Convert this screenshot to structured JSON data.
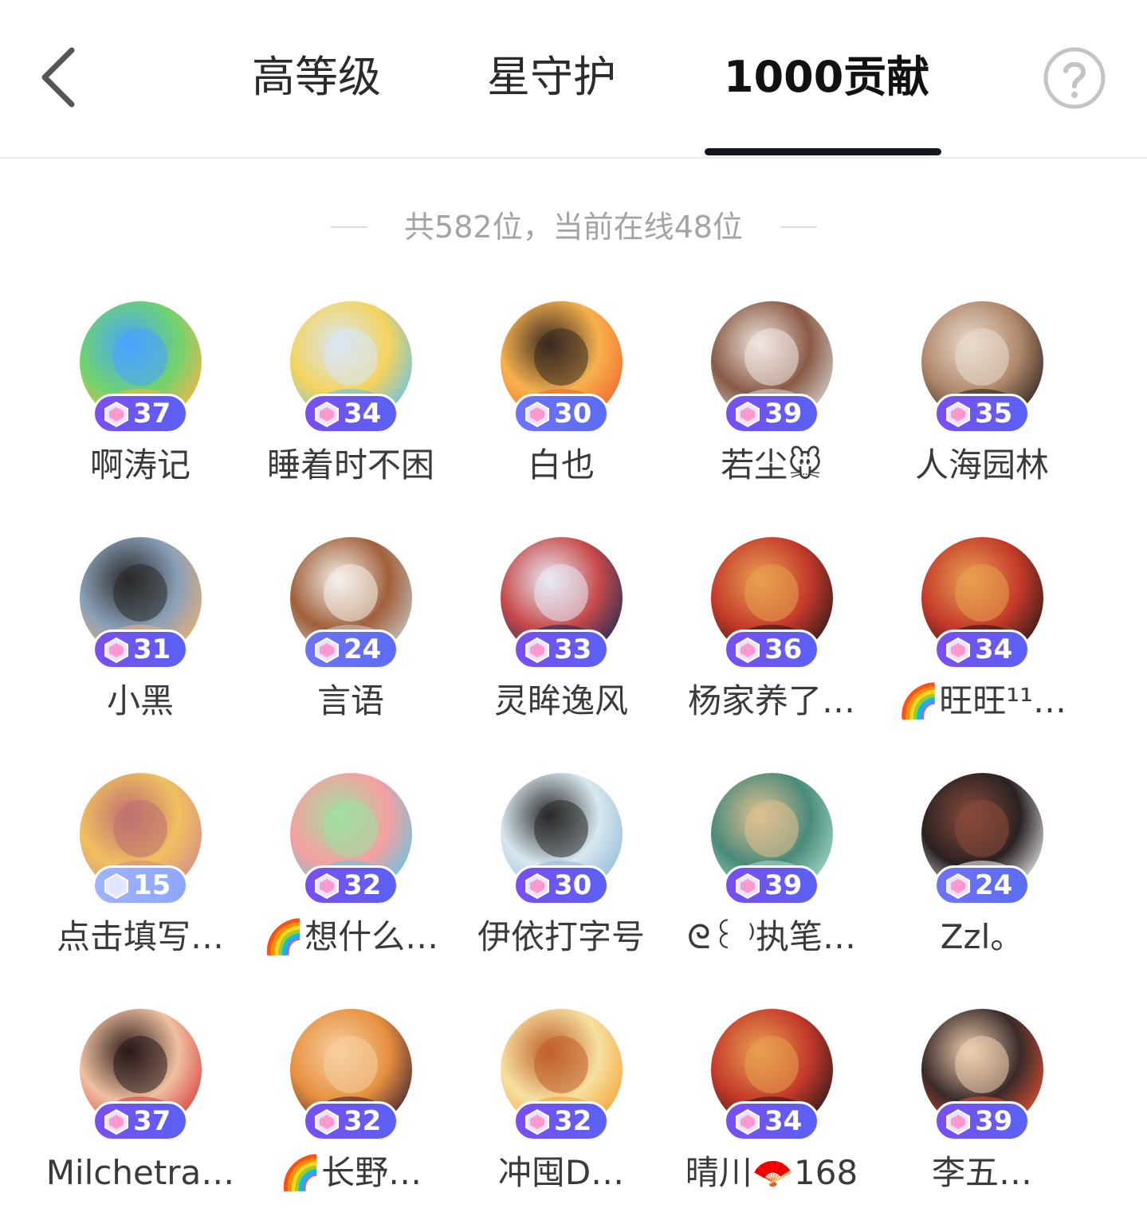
{
  "header": {
    "tabs": [
      {
        "label": "高等级",
        "active": false
      },
      {
        "label": "星守护",
        "active": false
      },
      {
        "label": "1000贡献",
        "active": true
      }
    ],
    "back_icon": "chevron-left-icon",
    "help_icon": "question-circle-icon"
  },
  "summary": {
    "text": "共582位，当前在线48位"
  },
  "members": [
    {
      "name": "啊涛记",
      "level": "37",
      "badge": "purple",
      "avatar_colors": [
        "#ffb347",
        "#6fd36f",
        "#4aa3ff"
      ]
    },
    {
      "name": "睡着时不困",
      "level": "34",
      "badge": "purple",
      "avatar_colors": [
        "#5ec2f0",
        "#f4d35e",
        "#d9e8f5"
      ]
    },
    {
      "name": "白也",
      "level": "30",
      "badge": "blue",
      "avatar_colors": [
        "#f0632b",
        "#f7b24d",
        "#3a2a20"
      ]
    },
    {
      "name": "若尘🐭",
      "level": "39",
      "badge": "purple",
      "avatar_colors": [
        "#d9d6d4",
        "#8a5a45",
        "#f0e6e0"
      ]
    },
    {
      "name": "人海园林",
      "level": "35",
      "badge": "purple",
      "avatar_colors": [
        "#2a2220",
        "#b0876a",
        "#e9ddd0"
      ]
    },
    {
      "name": "小黑",
      "level": "31",
      "badge": "purple",
      "avatar_colors": [
        "#f0b070",
        "#8aa0b8",
        "#2a2a2a"
      ]
    },
    {
      "name": "言语",
      "level": "24",
      "badge": "blue",
      "avatar_colors": [
        "#c9c9c9",
        "#a0603a",
        "#f5f0ea"
      ]
    },
    {
      "name": "灵眸逸风",
      "level": "33",
      "badge": "purple",
      "avatar_colors": [
        "#1a2a55",
        "#c74a4a",
        "#e8eaf5"
      ]
    },
    {
      "name": "杨家养了…",
      "level": "36",
      "badge": "purple",
      "avatar_colors": [
        "#2a1818",
        "#c43a2a",
        "#e8a050"
      ]
    },
    {
      "name": "🌈旺旺¹¹…",
      "level": "34",
      "badge": "purple",
      "avatar_colors": [
        "#2a1818",
        "#c43a2a",
        "#e8a050"
      ]
    },
    {
      "name": "点击填写…",
      "level": "15",
      "badge": "light",
      "avatar_colors": [
        "#d48a8a",
        "#f0c060",
        "#c07070"
      ]
    },
    {
      "name": "🌈想什么…",
      "level": "32",
      "badge": "purple",
      "avatar_colors": [
        "#5cc8e8",
        "#f5a0a0",
        "#9fe0a0"
      ]
    },
    {
      "name": "伊依打字号",
      "level": "30",
      "badge": "purple",
      "avatar_colors": [
        "#8fb8d8",
        "#d8e8f0",
        "#2a2a2a"
      ]
    },
    {
      "name": "ᘓ꒰ ⁾执笔…",
      "level": "39",
      "badge": "purple",
      "avatar_colors": [
        "#a8dccb",
        "#4a8a7a",
        "#e0c090"
      ]
    },
    {
      "name": "Zzl。",
      "level": "24",
      "badge": "blue",
      "avatar_colors": [
        "#eeeeee",
        "#2a2222",
        "#8a4a3a"
      ]
    },
    {
      "name": "Milchetra…",
      "level": "37",
      "badge": "purple",
      "avatar_colors": [
        "#d83a3a",
        "#f0c0a0",
        "#2a1a1a"
      ]
    },
    {
      "name": "🌈长野…",
      "level": "32",
      "badge": "purple",
      "avatar_colors": [
        "#3a2030",
        "#e89040",
        "#f5d0a0"
      ]
    },
    {
      "name": "冲囤D…",
      "level": "32",
      "badge": "purple",
      "avatar_colors": [
        "#f5a030",
        "#f7e0a0",
        "#c0602a"
      ]
    },
    {
      "name": "晴川🪭168",
      "level": "34",
      "badge": "purple",
      "avatar_colors": [
        "#2a1818",
        "#c43a2a",
        "#e8a050"
      ]
    },
    {
      "name": "李五…",
      "level": "39",
      "badge": "purple",
      "avatar_colors": [
        "#e85030",
        "#3a2a2a",
        "#f0d0b0"
      ]
    }
  ]
}
